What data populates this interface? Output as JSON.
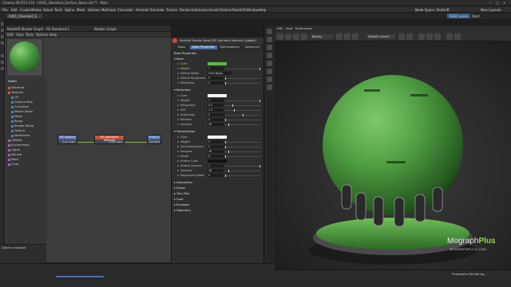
{
  "window": {
    "title": "Cinema 4D R23.110 - [0401_Standard_Surface_Base.c4d *] - Main",
    "controls": [
      "—",
      "□",
      "✕"
    ]
  },
  "menubar": {
    "items": [
      "File",
      "Edit",
      "Create",
      "Modes",
      "Select",
      "Tools",
      "Spline",
      "Mesh",
      "Volume",
      "MoGraph",
      "Character",
      "Animate",
      "Simulate",
      "Tracker",
      "Render",
      "Extensions",
      "Arnold",
      "Octane",
      "Redshift",
      "Window",
      "Help"
    ],
    "node_space": "Node Space: Redshift",
    "layout": "New Layouts"
  },
  "doc_tabs": {
    "active": "0401_Standard_S...",
    "start": "Start",
    "rs_tab": "RSSC Learn"
  },
  "shader_graph": {
    "title": "Redshift Shader Graph - RS Standard.1",
    "graph_title": "Shader Graph",
    "menu": [
      "Edit",
      "View",
      "Tools",
      "Options",
      "Help"
    ],
    "nodes_header": "Nodes",
    "tree": [
      {
        "label": "Materials",
        "color": "#d06030"
      },
      {
        "label": "Textures",
        "color": "#d06030"
      },
      {
        "label": "UV",
        "color": "#5a7abf"
      },
      {
        "label": "Camera Map",
        "color": "#5a7abf"
      },
      {
        "label": "Curvature",
        "color": "#5a7abf"
      },
      {
        "label": "Maxon Noise",
        "color": "#5a7abf"
      },
      {
        "label": "Noise",
        "color": "#5a7abf"
      },
      {
        "label": "Ramp",
        "color": "#5a7abf"
      },
      {
        "label": "Shader Ramp",
        "color": "#5a7abf"
      },
      {
        "label": "Texture",
        "color": "#5a7abf"
      },
      {
        "label": "WireFrame",
        "color": "#5a7abf"
      },
      {
        "label": "Utilities",
        "color": "#a55fbf"
      },
      {
        "label": "Environment",
        "color": "#a55fbf"
      },
      {
        "label": "Lights",
        "color": "#a55fbf"
      },
      {
        "label": "Volume",
        "color": "#a55fbf"
      },
      {
        "label": "Math",
        "color": "#a55fbf"
      },
      {
        "label": "Color",
        "color": "#a55fbf"
      }
    ],
    "bottom_label": "Generic material",
    "nodes": [
      {
        "title": "RS Texture",
        "port": "Out Color",
        "color": "#5a6ba8"
      },
      {
        "title": "RS Standard Material",
        "port": "Out Color",
        "color": "#c8503a"
      },
      {
        "title": "Output",
        "port": "Surface",
        "color": "#4b6fa8"
      }
    ]
  },
  "attributes": {
    "header": "Redshift Shader Node [RS Standard Material]",
    "custom": "Custom",
    "tabs": [
      "Basic",
      "Base Properties",
      "Optimizations",
      "Advanced"
    ],
    "active_tab": "Base Properties",
    "section_title": "Base Properties",
    "base": {
      "title": "Base",
      "rows": [
        {
          "label": "Color",
          "type": "swatch",
          "swatch": "#62b54b"
        },
        {
          "label": "Weight",
          "value": "1",
          "slider": 1.0
        },
        {
          "label": "Diffuse Model",
          "value": "Oren-Nayar"
        },
        {
          "label": "Diffuse Roughness",
          "value": "0",
          "slider": 0.0
        },
        {
          "label": "Metalness",
          "value": "0",
          "slider": 0.0
        }
      ]
    },
    "reflection": {
      "title": "Reflection",
      "rows": [
        {
          "label": "Color",
          "type": "swatch",
          "swatch": "#f4f4f4"
        },
        {
          "label": "Weight",
          "value": "1",
          "slider": 1.0
        },
        {
          "label": "Roughness",
          "value": "0.2",
          "slider": 0.2
        },
        {
          "label": "IOR",
          "value": "1.5",
          "slider": 0.25
        },
        {
          "label": "Anisotropy",
          "value": "0",
          "slider": 0.5
        },
        {
          "label": "Rotation",
          "value": "0",
          "slider": 0.0
        },
        {
          "label": "Samples",
          "value": "16",
          "slider": 0.1
        }
      ]
    },
    "transmission": {
      "title": "Transmission",
      "rows": [
        {
          "label": "Color",
          "type": "swatch",
          "swatch": "#f4f4f4"
        },
        {
          "label": "Weight",
          "value": "0",
          "slider": 0.0
        },
        {
          "label": "Extra Roughness",
          "value": "0",
          "slider": 0.0
        },
        {
          "label": "Samples",
          "value": "16",
          "slider": 0.1
        },
        {
          "label": "Depth",
          "value": "0",
          "slider": 0.0
        },
        {
          "label": "Scatter Color",
          "type": "swatch",
          "swatch": "#111111"
        },
        {
          "label": "Scatter Amount",
          "value": "1",
          "slider": 1.0
        },
        {
          "label": "Samples",
          "value": "16",
          "slider": 0.1
        },
        {
          "label": "Dispersion (Abbe)",
          "value": "0",
          "slider": 0.0
        }
      ]
    },
    "collapsed": [
      "Subsurface",
      "Sheen",
      "Thin Film",
      "Coat",
      "Emission",
      "Geometry"
    ]
  },
  "viewport": {
    "menu": [
      "Edit",
      "View",
      "Preferences"
    ],
    "renderer": "Beauty",
    "camera": "Default Camera",
    "status": "Progressive Rendering...",
    "watermark_brand": "Mograph",
    "watermark_brand_accent": "Plus",
    "watermark_url": "MOGRAPHPLUS.COM"
  },
  "colors": {
    "accent": "#4a6fa5",
    "sphere": "#4f9c41",
    "brand_green": "#9bd44a"
  }
}
